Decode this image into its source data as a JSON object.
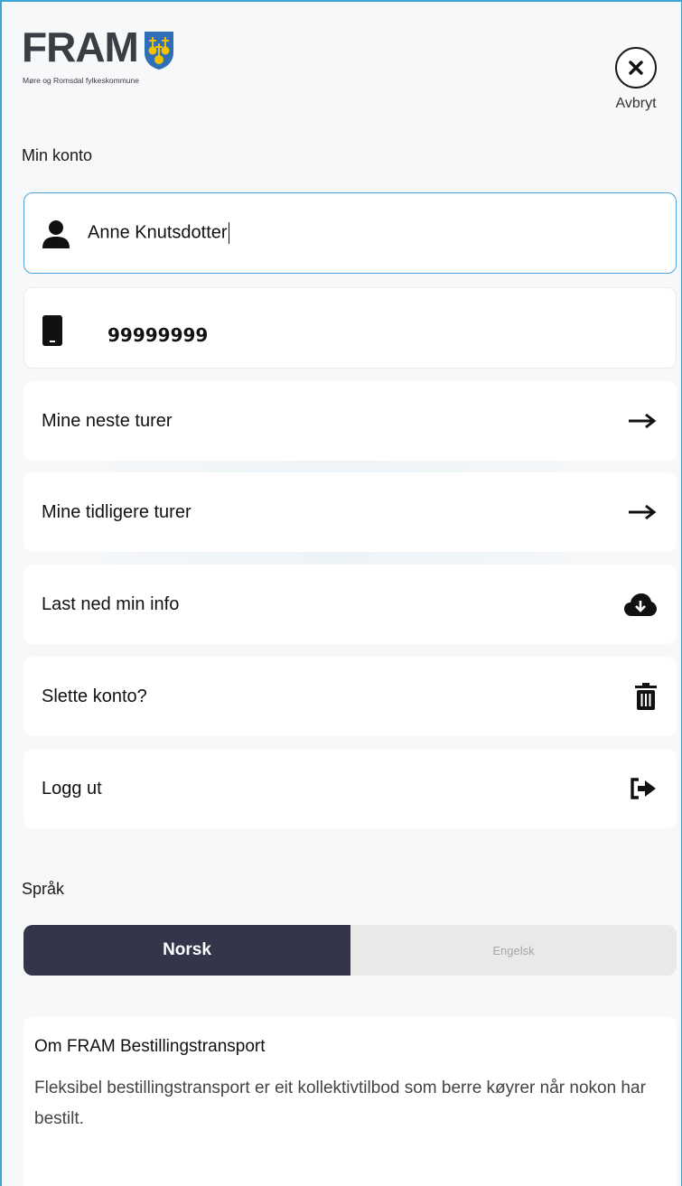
{
  "header": {
    "logo_text": "FRAM",
    "logo_subtitle": "Møre og Romsdal fylkeskommune",
    "close_label": "Avbryt",
    "brand_colors": {
      "dark": "#3b3d45",
      "shield_blue": "#2f6fb8",
      "shield_gold": "#f2c200"
    }
  },
  "account": {
    "section_title": "Min konto",
    "name_value": "Anne Knutsdotter",
    "phone_value": "99999999",
    "name_icon": "user-icon",
    "phone_icon": "mobile-phone-icon"
  },
  "menu": [
    {
      "label": "Mine neste turer",
      "icon": "arrow-right-icon"
    },
    {
      "label": "Mine tidligere turer",
      "icon": "arrow-right-icon"
    },
    {
      "label": "Last ned min info",
      "icon": "cloud-download-icon"
    },
    {
      "label": "Slette konto?",
      "icon": "trash-icon"
    },
    {
      "label": "Logg ut",
      "icon": "sign-out-icon"
    }
  ],
  "language": {
    "section_title": "Språk",
    "options": [
      "Norsk",
      "Engelsk"
    ],
    "selected": "Norsk",
    "active_color": "#33364a"
  },
  "about": {
    "title": "Om FRAM Bestillingstransport",
    "body": "Fleksibel bestillingstransport er eit kollektivtilbod som berre køyrer når nokon har bestilt."
  }
}
